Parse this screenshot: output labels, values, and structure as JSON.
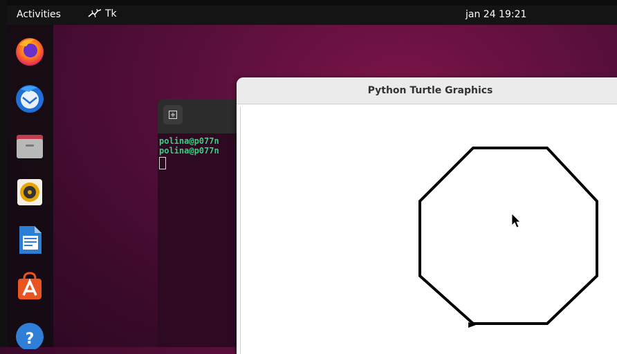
{
  "topbar": {
    "activities_label": "Activities",
    "app_icon": "tk-feather-icon",
    "app_name": "Tk",
    "clock": "jan 24  19:21"
  },
  "dock": {
    "items": [
      {
        "name": "Firefox",
        "icon": "firefox-icon"
      },
      {
        "name": "Thunderbird",
        "icon": "thunderbird-icon"
      },
      {
        "name": "Files",
        "icon": "files-icon"
      },
      {
        "name": "Rhythmbox",
        "icon": "rhythmbox-icon"
      },
      {
        "name": "LibreOffice Writer",
        "icon": "writer-icon"
      },
      {
        "name": "Ubuntu Software",
        "icon": "software-icon"
      },
      {
        "name": "Help",
        "icon": "help-icon"
      }
    ]
  },
  "terminal": {
    "newtab_icon": "new-tab-icon",
    "lines": [
      "polina@p077n",
      "polina@p077n"
    ]
  },
  "turtle_window": {
    "title": "Python Turtle Graphics",
    "shape": "octagon"
  }
}
